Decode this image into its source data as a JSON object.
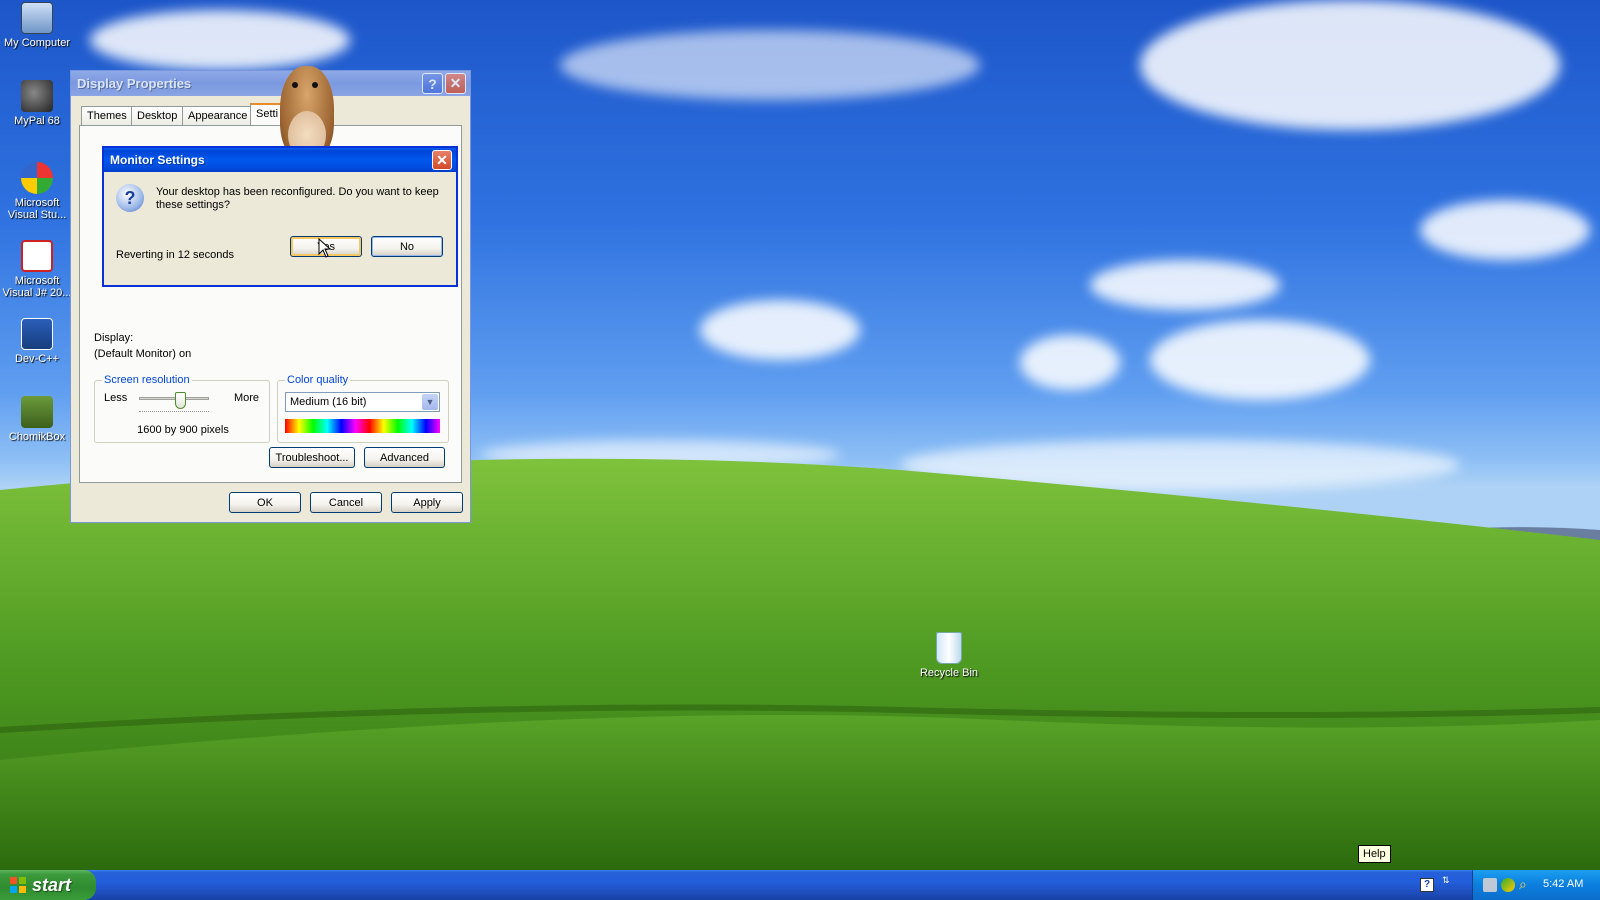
{
  "desktop": {
    "icons": [
      {
        "label": "My Computer",
        "icon": "computer-icon"
      },
      {
        "label": "MyPal 68",
        "icon": "mypal-browser-icon"
      },
      {
        "label": "Microsoft Visual Stu...",
        "icon": "visual-studio-icon"
      },
      {
        "label": "Microsoft Visual J# 20...",
        "icon": "visual-jsharp-icon"
      },
      {
        "label": "Dev-C++",
        "icon": "devcpp-icon"
      },
      {
        "label": "ChomikBox",
        "icon": "chomikbox-icon"
      },
      {
        "label": "Recycle Bin",
        "icon": "recycle-bin-icon"
      }
    ]
  },
  "display_properties": {
    "title": "Display Properties",
    "tabs": [
      "Themes",
      "Desktop",
      "Appearance",
      "Setti"
    ],
    "display_label": "Display:",
    "display_value": "(Default Monitor) on",
    "screen_resolution": {
      "group_label": "Screen resolution",
      "less": "Less",
      "more": "More",
      "value": "1600 by 900 pixels"
    },
    "color_quality": {
      "group_label": "Color quality",
      "selected": "Medium (16 bit)"
    },
    "buttons": {
      "troubleshoot": "Troubleshoot...",
      "advanced": "Advanced",
      "ok": "OK",
      "cancel": "Cancel",
      "apply": "Apply"
    }
  },
  "monitor_settings": {
    "title": "Monitor Settings",
    "message": "Your desktop has been reconfigured.  Do you want to keep these settings?",
    "countdown": "Reverting in 12 seconds",
    "yes_label": "Yes",
    "no_label": "No"
  },
  "tooltip": {
    "text": "Help"
  },
  "taskbar": {
    "start_label": "start",
    "clock": "5:42 AM"
  },
  "colors": {
    "title_active": "#0058ee",
    "title_inactive": "#7b99e0",
    "window_face": "#ece9d8",
    "taskbar": "#245edb",
    "start_green": "#3c9a3c"
  }
}
